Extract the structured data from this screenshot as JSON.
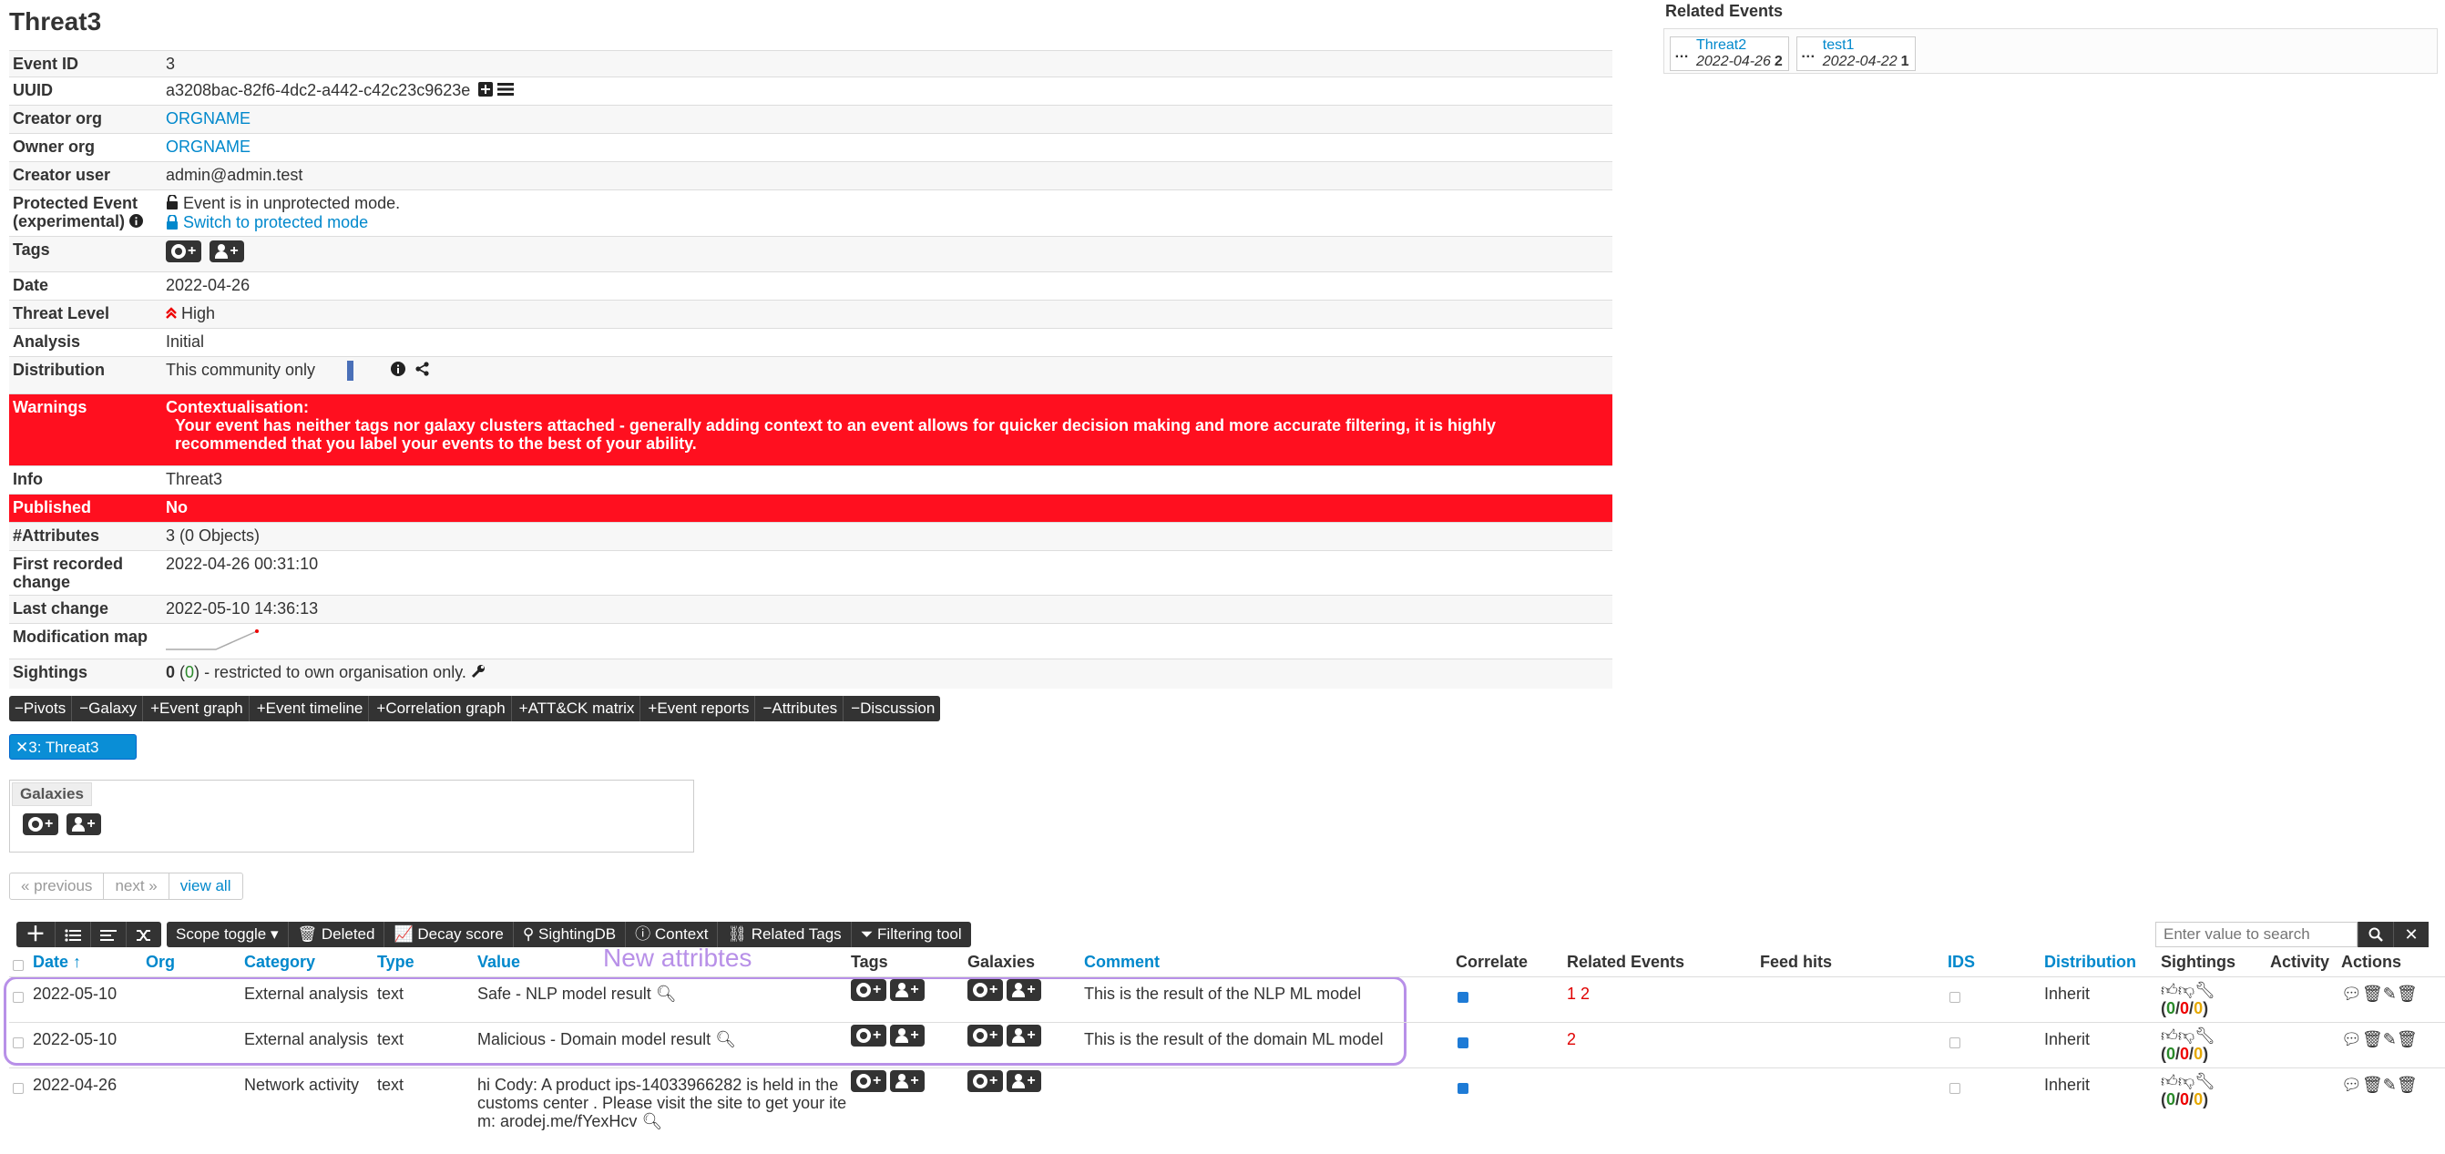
{
  "event": {
    "title": "Threat3",
    "rows": [
      {
        "label": "Event ID",
        "value": "3"
      },
      {
        "label": "UUID",
        "value": "a3208bac-82f6-4dc2-a442-c42c23c9623e"
      },
      {
        "label": "Creator org",
        "value": "ORGNAME"
      },
      {
        "label": "Owner org",
        "value": "ORGNAME"
      },
      {
        "label": "Creator user",
        "value": "admin@admin.test"
      },
      {
        "label": "Protected Event (experimental)",
        "value": "Event is in unprotected mode.",
        "link": "Switch to protected mode"
      },
      {
        "label": "Tags"
      },
      {
        "label": "Date",
        "value": "2022-04-26"
      },
      {
        "label": "Threat Level",
        "value": "High"
      },
      {
        "label": "Analysis",
        "value": "Initial"
      },
      {
        "label": "Distribution",
        "value": "This community only"
      },
      {
        "label": "Warnings",
        "title": "Contextualisation:",
        "value": "Your event has neither tags nor galaxy clusters attached - generally adding context to an event allows for quicker decision making and more accurate filtering, it is highly recommended that you label your events to the best of your ability."
      },
      {
        "label": "Info",
        "value": "Threat3"
      },
      {
        "label": "Published",
        "value": "No"
      },
      {
        "label": "#Attributes",
        "value": "3 (0 Objects)"
      },
      {
        "label": "First recorded change",
        "value": "2022-04-26 00:31:10"
      },
      {
        "label": "Last change",
        "value": "2022-05-10 14:36:13"
      },
      {
        "label": "Modification map"
      },
      {
        "label": "Sightings",
        "count": "0",
        "paren_open": "(",
        "paren_value": "0",
        "paren_close": ")",
        "value": "- restricted to own organisation only."
      }
    ]
  },
  "related_events": {
    "title": "Related Events",
    "items": [
      {
        "dots": "…",
        "name": "Threat2",
        "date": "2022-04-26",
        "count": "2"
      },
      {
        "dots": "…",
        "name": "test1",
        "date": "2022-04-22",
        "count": "1"
      }
    ]
  },
  "toggles": [
    "−Pivots",
    "−Galaxy",
    "+Event graph",
    "+Event timeline",
    "+Correlation graph",
    "+ATT&CK matrix",
    "+Event reports",
    "−Attributes",
    "−Discussion"
  ],
  "pivot": "✕3: Threat3",
  "galaxies_label": "Galaxies",
  "pager": {
    "prev": "« previous",
    "next": "next »",
    "all": "view all"
  },
  "attr_toolbar": {
    "scope": "Scope toggle ▾",
    "deleted": "Deleted",
    "decay": "Decay score",
    "sightingdb": "SightingDB",
    "context": "Context",
    "related_tags": "Related Tags",
    "filtering": "Filtering tool",
    "search_placeholder": "Enter value to search"
  },
  "annotation": "New attribtes",
  "attr_columns": {
    "date": "Date ↑",
    "org": "Org",
    "category": "Category",
    "type": "Type",
    "value": "Value",
    "tags": "Tags",
    "galaxies": "Galaxies",
    "comment": "Comment",
    "correlate": "Correlate",
    "related": "Related Events",
    "feed": "Feed hits",
    "ids": "IDS",
    "distribution": "Distribution",
    "sightings": "Sightings",
    "activity": "Activity",
    "actions": "Actions"
  },
  "attributes": [
    {
      "date": "2022-05-10",
      "category": "External analysis",
      "type": "text",
      "value": "Safe - NLP model result",
      "comment": "This is the result of the NLP ML model",
      "related": "1 2",
      "distribution": "Inherit",
      "s1": "0",
      "s2": "0",
      "s3": "0"
    },
    {
      "date": "2022-05-10",
      "category": "External analysis",
      "type": "text",
      "value": "Malicious - Domain model result",
      "comment": "This is the result of the domain ML model",
      "related": "2",
      "distribution": "Inherit",
      "s1": "0",
      "s2": "0",
      "s3": "0"
    },
    {
      "date": "2022-04-26",
      "category": "Network activity",
      "type": "text",
      "value": "hi Cody: A product ips-14033966282 is held in the customs center . Please visit the site to get your item: arodej.me/fYexHcv",
      "comment": "",
      "related": "",
      "distribution": "Inherit",
      "s1": "0",
      "s2": "0",
      "s3": "0"
    }
  ],
  "colors": {
    "danger": "#ff0f1f",
    "link": "#0088cc",
    "annotation": "#b890e8"
  }
}
